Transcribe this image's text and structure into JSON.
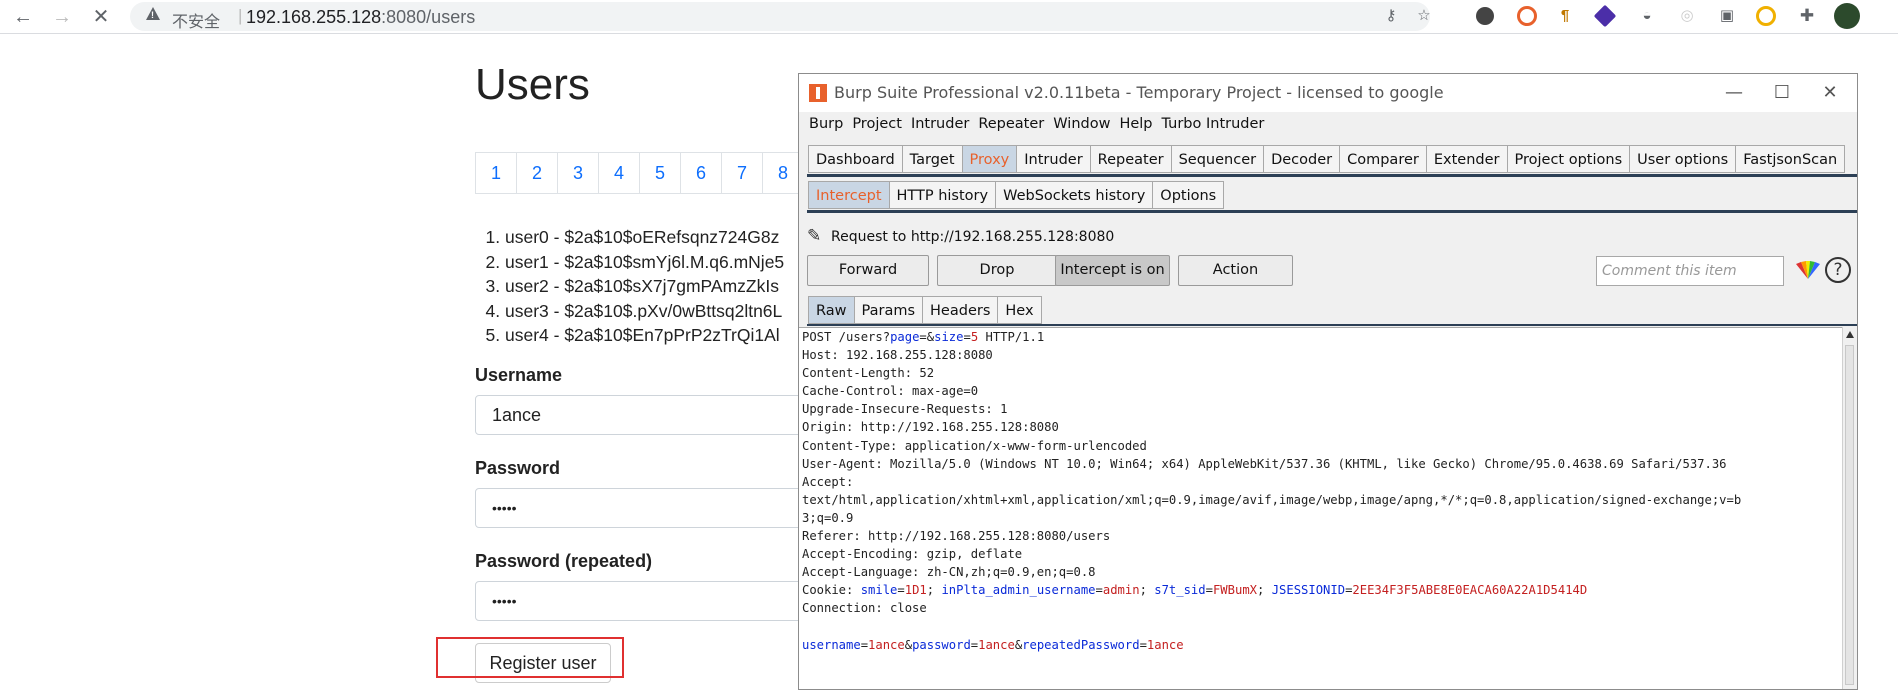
{
  "browser": {
    "insecure_label": "不安全",
    "separator": "|",
    "url_host": "192.168.255.128",
    "url_rest": ":8080/users"
  },
  "page": {
    "title": "Users",
    "pagination": [
      "1",
      "2",
      "3",
      "4",
      "5",
      "6",
      "7",
      "8"
    ],
    "users": [
      "user0 - $2a$10$oERefsqnz724G8z",
      "user1 - $2a$10$smYj6l.M.q6.mNje5",
      "user2 - $2a$10$sX7j7gmPAmzZkIs",
      "user3 - $2a$10$.pXv/0wBttsq2ltn6L",
      "user4 - $2a$10$En7pPrP2zTrQi1Al"
    ],
    "username_label": "Username",
    "username_value": "1ance",
    "password_label": "Password",
    "password_value": "•••••",
    "password_repeat_label": "Password (repeated)",
    "password_repeat_value": "•••••",
    "register_label": "Register user",
    "highlight_color": "#e03030"
  },
  "burp": {
    "title": "Burp Suite Professional v2.0.11beta - Temporary Project - licensed to google",
    "menu": [
      "Burp",
      "Project",
      "Intruder",
      "Repeater",
      "Window",
      "Help",
      "Turbo Intruder"
    ],
    "tabs": [
      "Dashboard",
      "Target",
      "Proxy",
      "Intruder",
      "Repeater",
      "Sequencer",
      "Decoder",
      "Comparer",
      "Extender",
      "Project options",
      "User options",
      "FastjsonScan"
    ],
    "active_tab": "Proxy",
    "subtabs": [
      "Intercept",
      "HTTP history",
      "WebSockets history",
      "Options"
    ],
    "active_subtab": "Intercept",
    "request_to": "Request to http://192.168.255.128:8080",
    "buttons": {
      "forward": "Forward",
      "drop": "Drop",
      "intercept": "Intercept is on",
      "action": "Action"
    },
    "comment_placeholder": "Comment this item",
    "help": "?",
    "view_tabs": [
      "Raw",
      "Params",
      "Headers",
      "Hex"
    ],
    "active_view": "Raw",
    "accent_color": "#e8612c",
    "request": {
      "line1_pre": "POST /users?",
      "p_page": "page",
      "eq_amp": "=&",
      "p_size": "size",
      "eq": "=",
      "v_size": "5",
      "line1_post": " HTTP/1.1",
      "headers": [
        "Host: 192.168.255.128:8080",
        "Content-Length: 52",
        "Cache-Control: max-age=0",
        "Upgrade-Insecure-Requests: 1",
        "Origin: http://192.168.255.128:8080",
        "Content-Type: application/x-www-form-urlencoded",
        "User-Agent: Mozilla/5.0 (Windows NT 10.0; Win64; x64) AppleWebKit/537.36 (KHTML, like Gecko) Chrome/95.0.4638.69 Safari/537.36",
        "Accept:",
        "text/html,application/xhtml+xml,application/xml;q=0.9,image/avif,image/webp,image/apng,*/*;q=0.8,application/signed-exchange;v=b",
        "3;q=0.9",
        "Referer: http://192.168.255.128:8080/users",
        "Accept-Encoding: gzip, deflate",
        "Accept-Language: zh-CN,zh;q=0.9,en;q=0.8"
      ],
      "cookie_prefix": "Cookie: ",
      "cookies": [
        {
          "name": "smile",
          "value": "1D1"
        },
        {
          "name": "inPlta_admin_username",
          "value": "admin"
        },
        {
          "name": "s7t_sid",
          "value": "FWBumX"
        },
        {
          "name": "JSESSIONID",
          "value": "2EE34F3F5ABE8E0EACA60A22A1D5414D"
        }
      ],
      "connection": "Connection: close",
      "body": [
        {
          "name": "username",
          "value": "1ance"
        },
        {
          "name": "password",
          "value": "1ance"
        },
        {
          "name": "repeatedPassword",
          "value": "1ance"
        }
      ]
    }
  }
}
